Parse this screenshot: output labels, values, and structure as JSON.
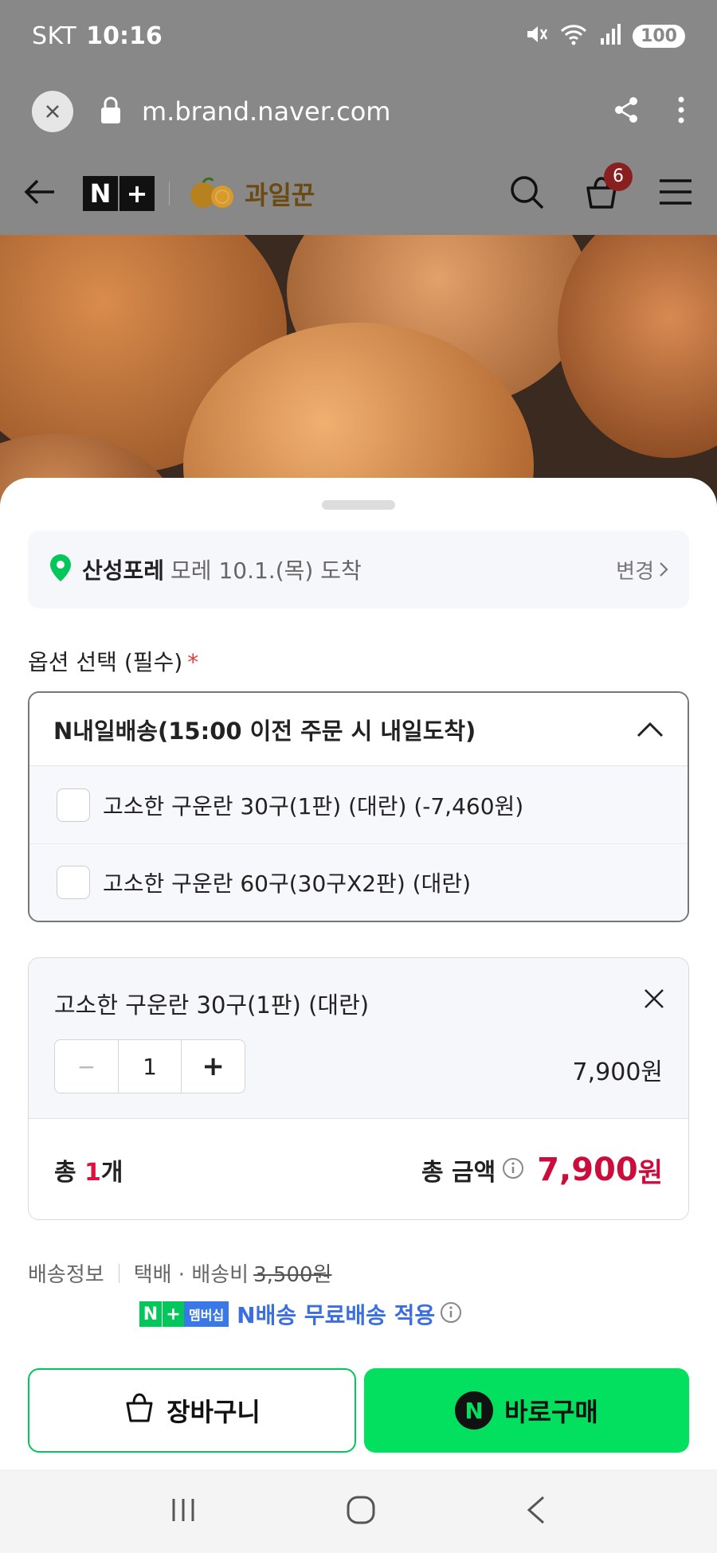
{
  "status_bar": {
    "carrier": "SKT",
    "time": "10:16",
    "battery": "100"
  },
  "browser": {
    "url": "m.brand.naver.com"
  },
  "site_header": {
    "logo_text": "N+",
    "brand_name": "과일꾼",
    "cart_count": "6"
  },
  "sheet": {
    "delivery": {
      "location": "산성포레",
      "date_text": "모레 10.1.(목) 도착",
      "change_label": "변경"
    },
    "option_label": "옵션 선택 (필수)",
    "required_mark": "*",
    "dropdown": {
      "title": "N내일배송(15:00 이전 주문 시 내일도착)",
      "options": [
        {
          "label": "고소한 구운란 30구(1판) (대란) (-7,460원)"
        },
        {
          "label": "고소한 구운란 60구(30구X2판) (대란)"
        }
      ]
    },
    "selected_item": {
      "name": "고소한 구운란 30구(1판) (대란)",
      "minus": "−",
      "quantity": "1",
      "plus": "+",
      "price": "7,900원"
    },
    "total": {
      "count_prefix": "총 ",
      "count": "1",
      "count_suffix": "개",
      "amount_label": "총 금액",
      "amount": "7,900",
      "currency": "원"
    },
    "shipping": {
      "label": "배송정보",
      "method": "택배 · 배송비",
      "original_fee": "3,500원",
      "membership_badge": "멤버십",
      "free_text": "N배송 무료배송 적용"
    },
    "buttons": {
      "cart": "장바구니",
      "buy": "바로구매"
    }
  },
  "colors": {
    "accent_green": "#03c75a",
    "price_red": "#cc0d3b",
    "dim": "#888888"
  }
}
